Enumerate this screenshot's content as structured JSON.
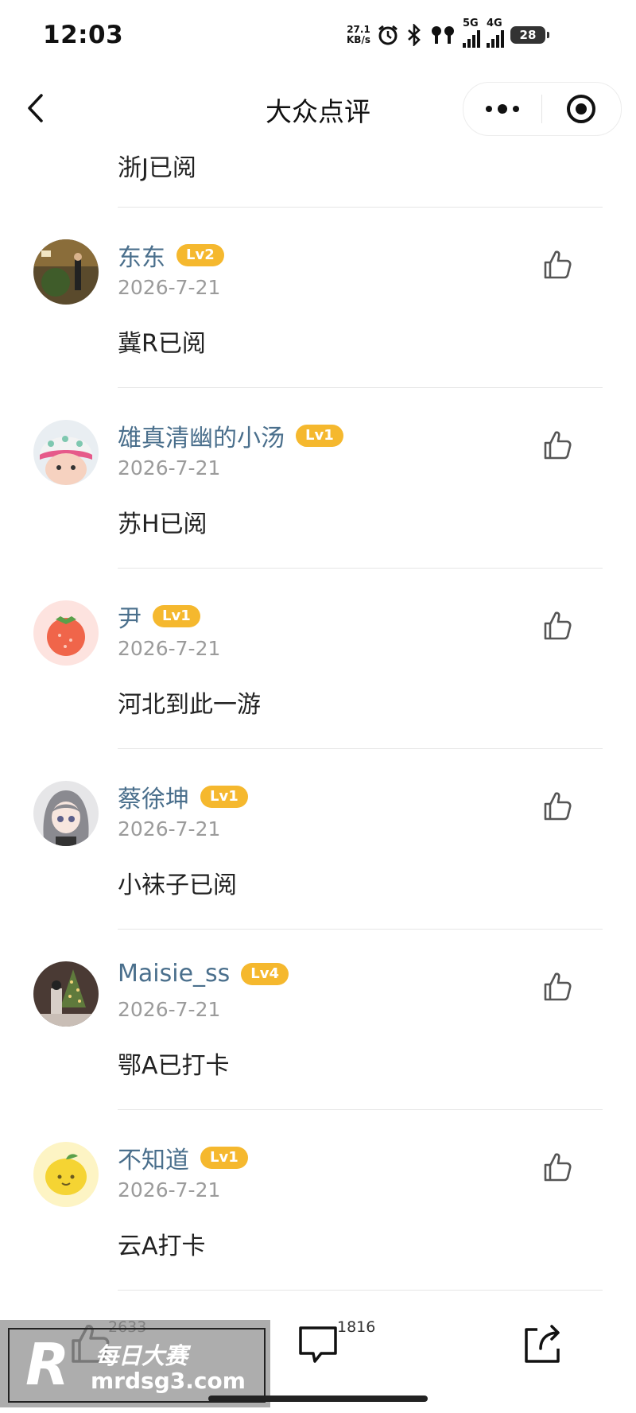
{
  "status_bar": {
    "time": "12:03",
    "net_speed_value": "27.1",
    "net_speed_unit": "KB/s",
    "signal_1_label": "5G",
    "signal_2_label": "4G",
    "battery": "28"
  },
  "nav": {
    "title": "大众点评"
  },
  "first_comment_text": "浙J已阅",
  "comments": [
    {
      "name": "东东",
      "level": "Lv2",
      "date": "2026-7-21",
      "text": "冀R已阅"
    },
    {
      "name": "雄真清幽的小汤",
      "level": "Lv1",
      "date": "2026-7-21",
      "text": "苏H已阅"
    },
    {
      "name": "尹",
      "level": "Lv1",
      "date": "2026-7-21",
      "text": "河北到此一游"
    },
    {
      "name": "蔡徐坤",
      "level": "Lv1",
      "date": "2026-7-21",
      "text": "小袜子已阅"
    },
    {
      "name": "Maisie_ss",
      "level": "Lv4",
      "date": "2026-7-21",
      "text": "鄂A已打卡"
    },
    {
      "name": "不知道",
      "level": "Lv1",
      "date": "2026-7-21",
      "text": "云A打卡"
    }
  ],
  "bottom_bar": {
    "like_count": "2633",
    "comment_count": "1816"
  },
  "watermark": {
    "logo_letter": "R",
    "brand": "每日大赛",
    "url": "mrdsg3.com"
  },
  "colors": {
    "username": "#4a6f8c",
    "level_badge": "#f5b82e",
    "date": "#9b9b9b"
  }
}
